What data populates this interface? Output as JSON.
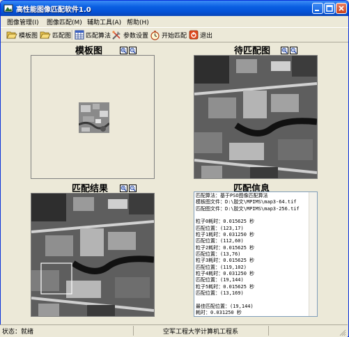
{
  "window": {
    "title": "高性能图像匹配软件1.0"
  },
  "menu": {
    "items": [
      "图像管理(I)",
      "图像匹配(M)",
      "辅助工具(A)",
      "帮助(H)"
    ]
  },
  "toolbar": {
    "template_image": "模板图",
    "match_image": "匹配图",
    "match_algorithm": "匹配算法",
    "param_settings": "参数设置",
    "start_match": "开始匹配",
    "exit": "退出"
  },
  "panels": {
    "template_title": "模板图",
    "target_title": "待匹配图",
    "result_title": "匹配结果",
    "info_title": "匹配信息"
  },
  "match_info": {
    "lines": [
      "匹配算法：基于PSO图像匹配算法",
      "模板图文件：D:\\胶文\\MPIMS\\map3-64.tif",
      "匹配图文件：D:\\胶文\\MPIMS\\map3-256.tif",
      "",
      "粒子0耗时：0.015625 秒",
      "匹配位置：(123,17)",
      "粒子1耗时：0.031250 秒",
      "匹配位置：(112,60)",
      "粒子2耗时：0.015625 秒",
      "匹配位置：(13,76)",
      "粒子3耗时：0.015625 秒",
      "匹配位置：(119,102)",
      "粒子4耗时：0.031250 秒",
      "匹配位置：(19,144)",
      "粒子5耗时：0.015625 秒",
      "匹配位置：(13,169)",
      "",
      "最佳匹配位置：(19,144)",
      "耗时：0.031250 秒"
    ]
  },
  "status": {
    "state": "状态：就绪",
    "org": "空军工程大学计算机工程系"
  },
  "colors": {
    "titlebar": "#0a5fe2",
    "face": "#ece9d8",
    "template_bg": "#ede9d9"
  }
}
